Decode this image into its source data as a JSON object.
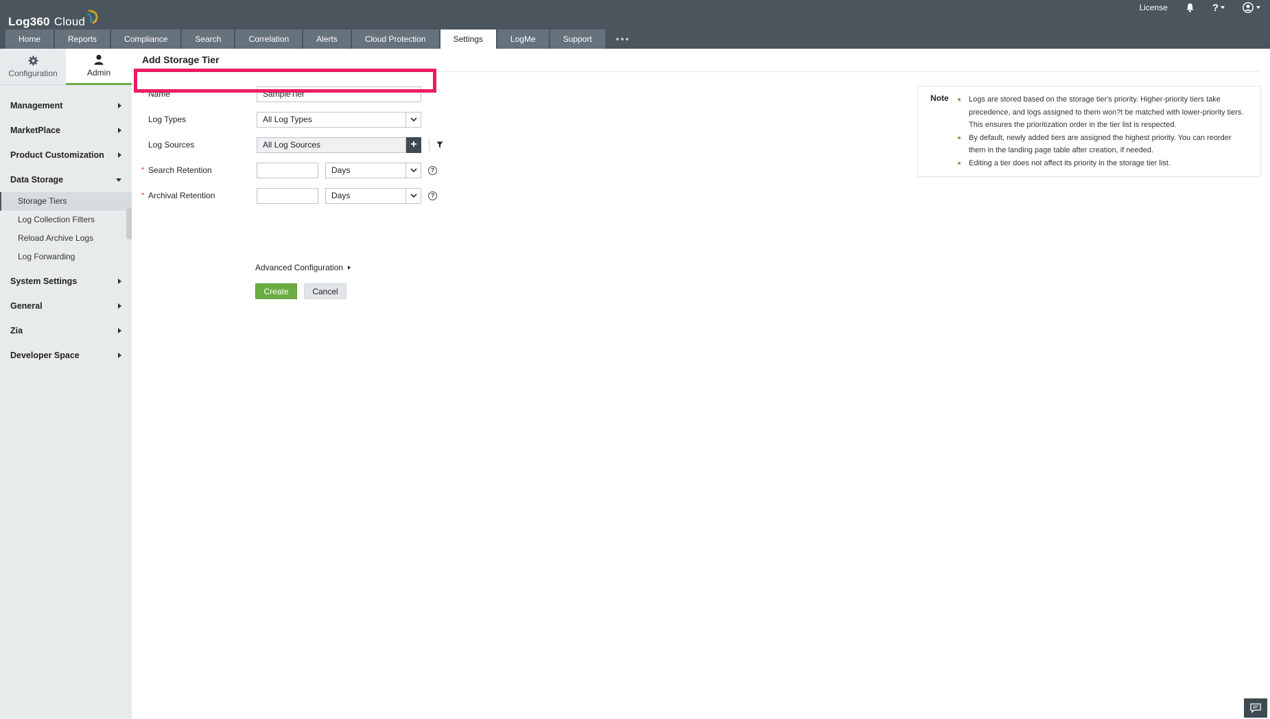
{
  "app": {
    "logo_text": "Log360",
    "logo_sub": "Cloud",
    "license_label": "License",
    "help_label": "?"
  },
  "nav": {
    "tabs": [
      {
        "label": "Home"
      },
      {
        "label": "Reports"
      },
      {
        "label": "Compliance"
      },
      {
        "label": "Search"
      },
      {
        "label": "Correlation"
      },
      {
        "label": "Alerts"
      },
      {
        "label": "Cloud Protection"
      },
      {
        "label": "Settings"
      },
      {
        "label": "LogMe"
      },
      {
        "label": "Support"
      }
    ],
    "active_tab": "Settings"
  },
  "sidebar": {
    "tabs": [
      {
        "label": "Configuration",
        "icon": "gear-icon"
      },
      {
        "label": "Admin",
        "icon": "user-icon"
      }
    ],
    "active_tab": "Admin",
    "sections": [
      {
        "label": "Management",
        "expanded": false
      },
      {
        "label": "MarketPlace",
        "expanded": false
      },
      {
        "label": "Product Customization",
        "expanded": false
      },
      {
        "label": "Data Storage",
        "expanded": true,
        "items": [
          "Storage Tiers",
          "Log Collection Filters",
          "Reload Archive Logs",
          "Log Forwarding"
        ]
      },
      {
        "label": "System Settings",
        "expanded": false
      },
      {
        "label": "General",
        "expanded": false
      },
      {
        "label": "Zia",
        "expanded": false
      },
      {
        "label": "Developer Space",
        "expanded": false
      }
    ],
    "active_item": "Storage Tiers"
  },
  "page": {
    "title": "Add Storage Tier"
  },
  "form": {
    "required_mark": "*",
    "name_label": "Name",
    "name_value": "SampleTier",
    "log_types_label": "Log Types",
    "log_types_value": "All Log Types",
    "log_sources_label": "Log Sources",
    "log_sources_value": "All Log Sources",
    "add_symbol": "+",
    "search_retention_label": "Search Retention",
    "search_retention_value": "",
    "search_retention_unit": "Days",
    "archival_retention_label": "Archival Retention",
    "archival_retention_value": "",
    "archival_retention_unit": "Days",
    "help_symbol": "?",
    "advanced_label": "Advanced Configuration",
    "create_label": "Create",
    "cancel_label": "Cancel"
  },
  "note": {
    "title": "Note",
    "items": [
      "Logs are stored based on the storage tier's priority. Higher-priority tiers take precedence, and logs assigned to them won?t be matched with lower-priority tiers. This ensures the prioritization order in the tier list is respected.",
      "By default, newly added tiers are assigned the highest priority. You can reorder them in the landing page table after creation, if needed.",
      "Editing a tier does not affect its priority in the storage tier list."
    ]
  },
  "colors": {
    "header_bg": "#4a555e",
    "accent_green": "#6cac44",
    "highlight_border": "#ec1c60",
    "required_red": "#e5352a"
  }
}
